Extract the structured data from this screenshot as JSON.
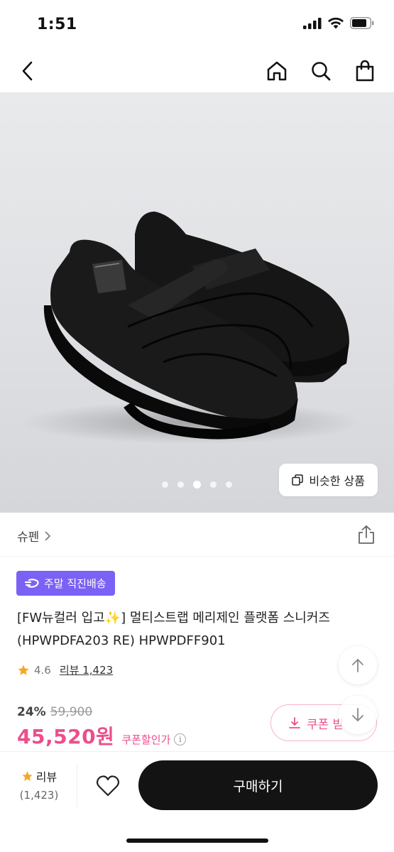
{
  "status": {
    "time": "1:51"
  },
  "nav": {
    "back_icon": "chevron-left-icon",
    "home_icon": "home-icon",
    "search_icon": "search-icon",
    "cart_icon": "shopping-bag-icon"
  },
  "gallery": {
    "pages": 5,
    "active_index": 2,
    "similar_label": "비슷한 상품"
  },
  "brand": {
    "name": "슈펜",
    "chevron": "›"
  },
  "badge": {
    "label": "주말 직진배송",
    "color": "#7b61f4"
  },
  "product": {
    "title": "[FW뉴컬러 입고✨] 멀티스트랩 메리제인 플랫폼 스니커즈 (HPWPDFA203 RE) HPWPDFF901",
    "rating": "4.6",
    "review_link": "리뷰 1,423"
  },
  "price": {
    "discount": "24%",
    "original": "59,900",
    "sale": "45,520원",
    "coupon_label": "쿠폰할인가",
    "accent_color": "#ec4e8c"
  },
  "coupon_button": {
    "label": "쿠폰 받"
  },
  "bottom": {
    "review_label": "리뷰",
    "review_count": "(1,423)",
    "buy_label": "구매하기"
  }
}
